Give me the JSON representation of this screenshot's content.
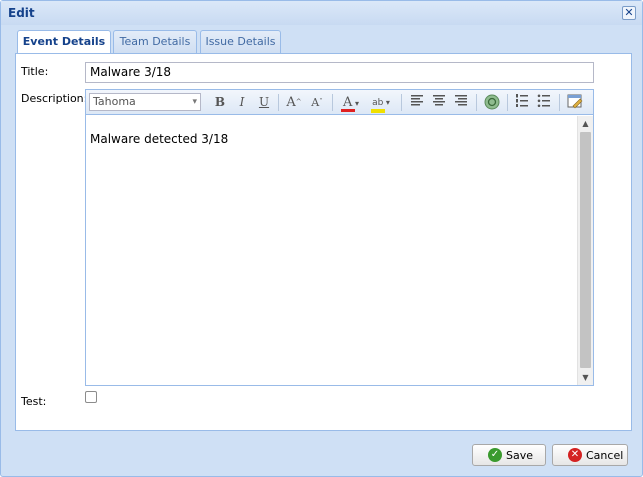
{
  "window": {
    "title": "Edit"
  },
  "tabs": [
    {
      "label": "Event Details",
      "active": true
    },
    {
      "label": "Team Details",
      "active": false
    },
    {
      "label": "Issue Details",
      "active": false
    }
  ],
  "form": {
    "title_label": "Title:",
    "title_value": "Malware 3/18",
    "description_label": "Description:",
    "font_family": "Tahoma",
    "description_text": "Malware detected 3/18",
    "test_label": "Test:",
    "test_checked": false
  },
  "toolbar": {
    "buttons": [
      "bold",
      "italic",
      "underline",
      "increase-font-size",
      "decrease-font-size",
      "font-color",
      "highlight-color",
      "align-left",
      "align-center",
      "align-right",
      "insert-link",
      "numbered-list",
      "bulleted-list",
      "source-edit"
    ],
    "glyphs": {
      "bold": "B",
      "italic": "I",
      "underline": "U",
      "increase": "A",
      "decrease": "A",
      "font_color": "A",
      "highlight": "ab"
    },
    "dropdown_arrow": "▾"
  },
  "footer": {
    "save_label": "Save",
    "cancel_label": "Cancel"
  },
  "colors": {
    "header": "#15428b",
    "border": "#99bbe8",
    "save_icon": "#3a9a2e",
    "cancel_icon": "#d42121",
    "font_color_bar": "#e02020",
    "highlight_bar": "#f0e000"
  }
}
